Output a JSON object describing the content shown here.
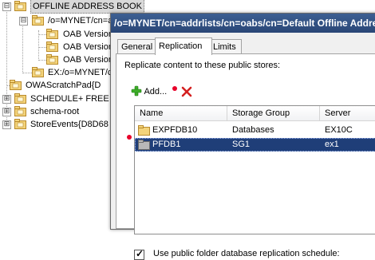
{
  "tree": {
    "items": [
      {
        "label": "OFFLINE ADDRESS BOOK",
        "expander": "⊟"
      },
      {
        "label": "/o=MYNET/cn=a",
        "expander": "⊟"
      },
      {
        "label": "OAB Version",
        "expander": ""
      },
      {
        "label": "OAB Version",
        "expander": ""
      },
      {
        "label": "OAB Version",
        "expander": ""
      },
      {
        "label": "EX:/o=MYNET/c",
        "expander": ""
      },
      {
        "label": "OWAScratchPad{D",
        "expander": ""
      },
      {
        "label": "SCHEDULE+ FREE B",
        "expander": "⊞"
      },
      {
        "label": "schema-root",
        "expander": "⊞"
      },
      {
        "label": "StoreEvents{D8D68",
        "expander": "⊞"
      }
    ]
  },
  "dialog": {
    "title": "/o=MYNET/cn=addrlists/cn=oabs/cn=Default Offline Address Book Properties",
    "tabs": [
      "General",
      "Replication",
      "Limits"
    ],
    "active_tab": "Replication",
    "replicate_label": "Replicate content to these public stores:",
    "add_label": "Add...",
    "columns": [
      "Name",
      "Storage Group",
      "Server"
    ],
    "rows": [
      {
        "name": "EXPFDB10",
        "group": "Databases",
        "server": "EX10C",
        "selected": false
      },
      {
        "name": "PFDB1",
        "group": "SG1",
        "server": "ex1",
        "selected": true
      }
    ],
    "schedule_label": "Use public folder database replication schedule:",
    "schedule_checked": true
  },
  "colors": {
    "titlebar": "#2a4676",
    "selection": "#1f3e78",
    "annotation_dot": "#e8002a"
  }
}
